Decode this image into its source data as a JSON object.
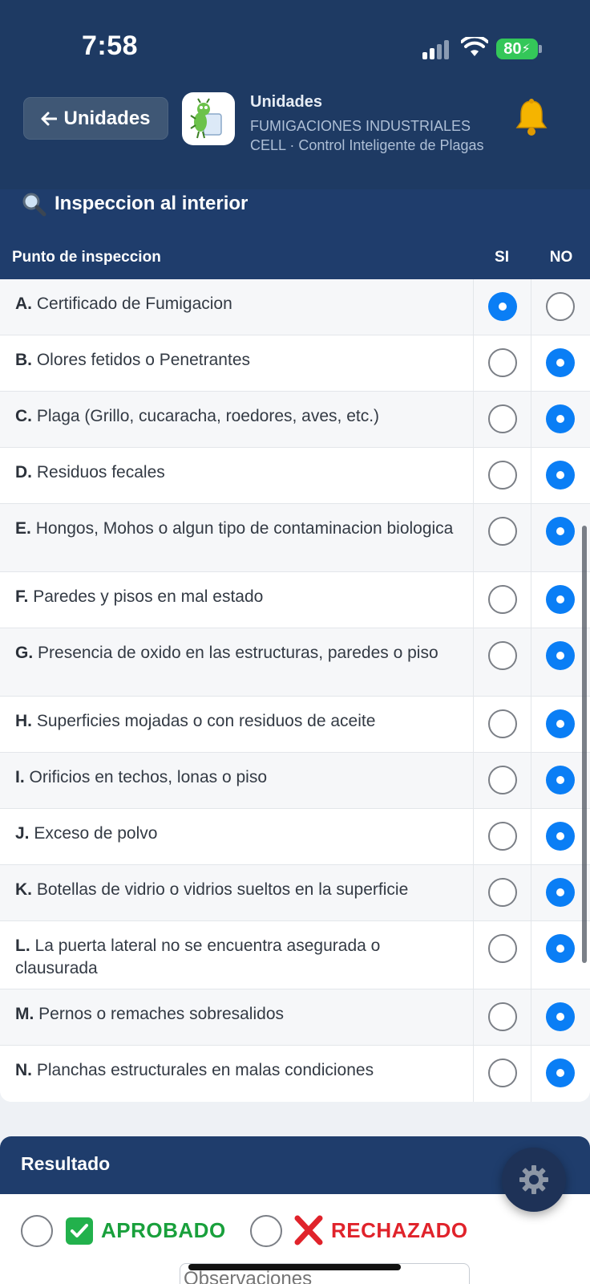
{
  "status_bar": {
    "time": "7:58",
    "battery": "80"
  },
  "header": {
    "back_label": "Unidades",
    "title": "Unidades",
    "subtitle": "FUMIGACIONES INDUSTRIALES CELL · Control Inteligente de Plagas"
  },
  "section": {
    "title": "Inspeccion al interior"
  },
  "table": {
    "col_point": "Punto de inspeccion",
    "col_si": "SI",
    "col_no": "NO",
    "rows": [
      {
        "letter": "A.",
        "text": "Certificado de Fumigacion",
        "answer": "SI"
      },
      {
        "letter": "B.",
        "text": "Olores fetidos o Penetrantes",
        "answer": "NO"
      },
      {
        "letter": "C.",
        "text": "Plaga (Grillo, cucaracha, roedores, aves, etc.)",
        "answer": "NO"
      },
      {
        "letter": "D.",
        "text": "Residuos fecales",
        "answer": "NO"
      },
      {
        "letter": "E.",
        "text": "Hongos, Mohos o algun tipo de contaminacion biologica",
        "answer": "NO"
      },
      {
        "letter": "F.",
        "text": "Paredes y pisos en mal estado",
        "answer": "NO"
      },
      {
        "letter": "G.",
        "text": "Presencia de oxido en las estructuras, paredes o piso",
        "answer": "NO"
      },
      {
        "letter": "H.",
        "text": "Superficies mojadas o con residuos de aceite",
        "answer": "NO"
      },
      {
        "letter": "I.",
        "text": "Orificios en techos, lonas o piso",
        "answer": "NO"
      },
      {
        "letter": "J.",
        "text": "Exceso de polvo",
        "answer": "NO"
      },
      {
        "letter": "K.",
        "text": "Botellas de vidrio o vidrios sueltos en la superficie",
        "answer": "NO"
      },
      {
        "letter": "L.",
        "text": "La puerta lateral no se encuentra asegurada o clausurada",
        "answer": "NO"
      },
      {
        "letter": "M.",
        "text": "Pernos o remaches sobresalidos",
        "answer": "NO"
      },
      {
        "letter": "N.",
        "text": "Planchas estructurales en malas condiciones",
        "answer": "NO"
      }
    ]
  },
  "result": {
    "title": "Resultado",
    "approved_label": "APROBADO",
    "rejected_label": "RECHAZADO",
    "observations_placeholder": "Observaciones"
  },
  "colors": {
    "primary": "#1f3d6c",
    "accent": "#0a7ef5",
    "approved": "#19a03c",
    "rejected": "#e0232b"
  },
  "icons": [
    "back-arrow-icon",
    "app-logo-icon",
    "bell-icon",
    "magnifier-icon",
    "check-icon",
    "x-icon",
    "gear-icon"
  ]
}
